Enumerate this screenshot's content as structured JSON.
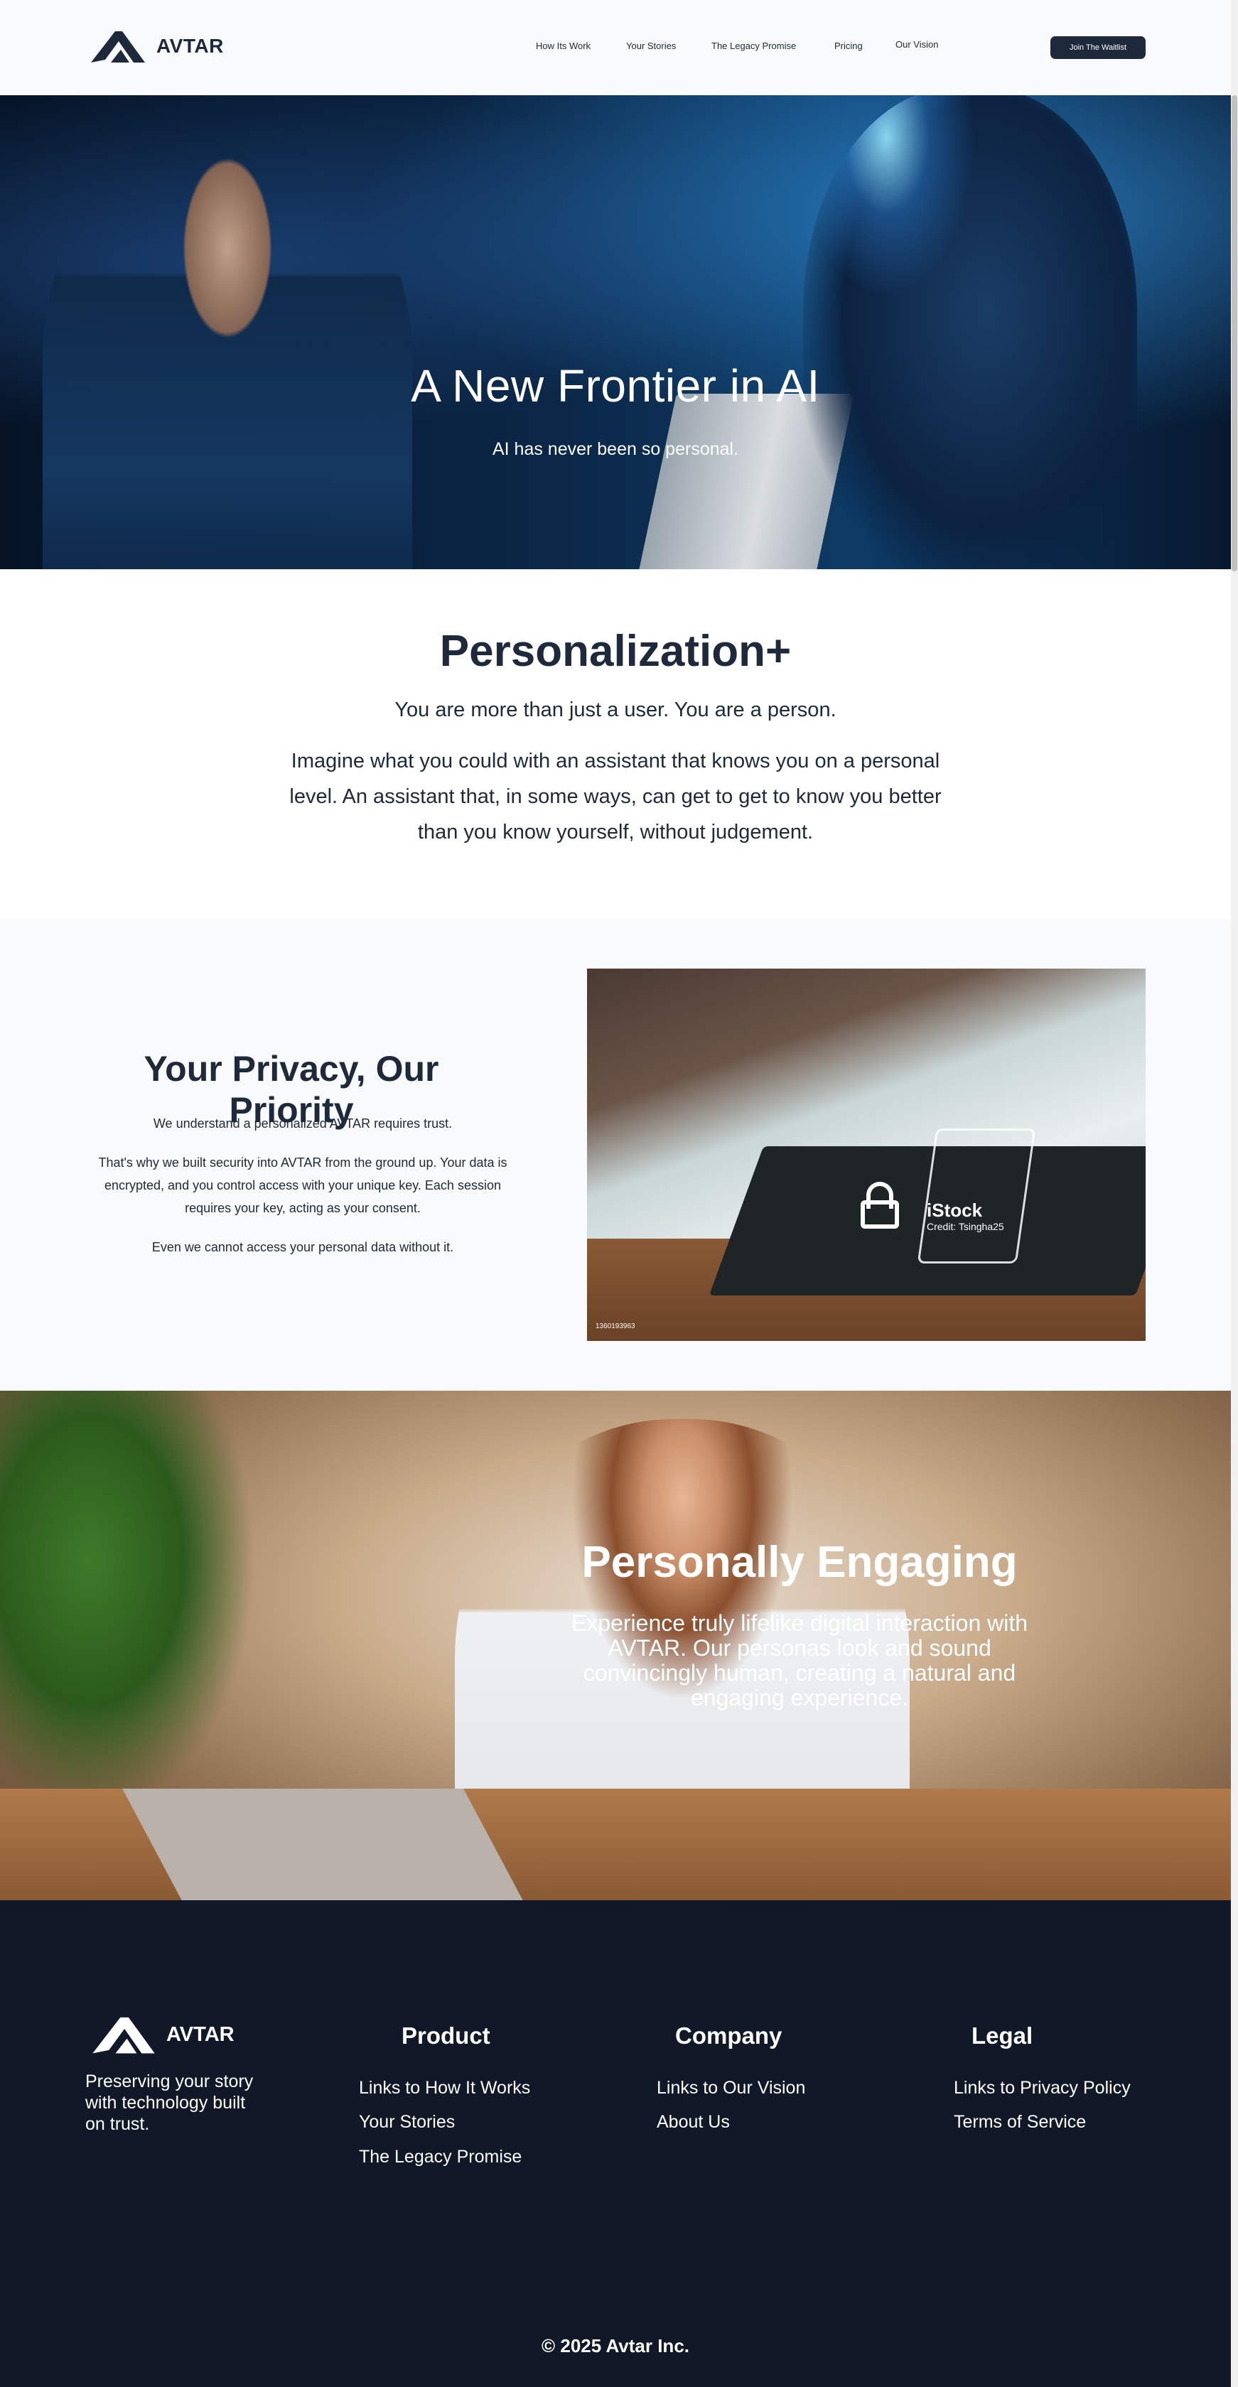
{
  "brand": {
    "name": "AVTAR"
  },
  "nav": {
    "links": [
      "How Its Work",
      "Your Stories",
      "The Legacy Promise",
      "Pricing",
      "Our Vision"
    ],
    "cta": "Join The Waitlist"
  },
  "hero": {
    "title": "A New Frontier in AI",
    "subtitle": "AI has never been so personal."
  },
  "personalization": {
    "title": "Personalization+",
    "subtitle": "You are more than just a user. You are a person.",
    "body": "Imagine what you could with an assistant that knows you on a personal level. An assistant that, in some ways, can get to get to know you better than you know yourself, without judgement."
  },
  "privacy": {
    "title": "Your Privacy, Our Priority",
    "paragraphs": [
      "We understand a personalized AVTAR requires trust.",
      "That's why we built security into AVTAR from the ground up. Your data is encrypted, and you control access with your unique key. Each session requires your key, acting as your consent.",
      "Even we cannot access your personal data without it."
    ],
    "image": {
      "watermark": "iStock",
      "credit": "Credit: Tsingha25",
      "id": "1360193963"
    }
  },
  "engaging": {
    "title": "Personally Engaging",
    "body": "Experience truly lifelike digital interaction with AVTAR. Our personas look and sound convincingly human, creating a natural and engaging experience."
  },
  "footer": {
    "tagline": " Preserving your story with technology built on trust.",
    "columns": [
      {
        "title": "Product",
        "links": [
          "Links to How It Works",
          "Your Stories",
          "The Legacy Promise"
        ]
      },
      {
        "title": "Company",
        "links": [
          "Links to Our Vision",
          "About Us"
        ]
      },
      {
        "title": "Legal",
        "links": [
          "Links to Privacy Policy",
          "Terms of Service"
        ]
      }
    ],
    "copyright": "© 2025 Avtar Inc."
  },
  "colors": {
    "navy": "#1e293b",
    "footer_bg": "#111827",
    "section_bg": "#f8fafc"
  }
}
